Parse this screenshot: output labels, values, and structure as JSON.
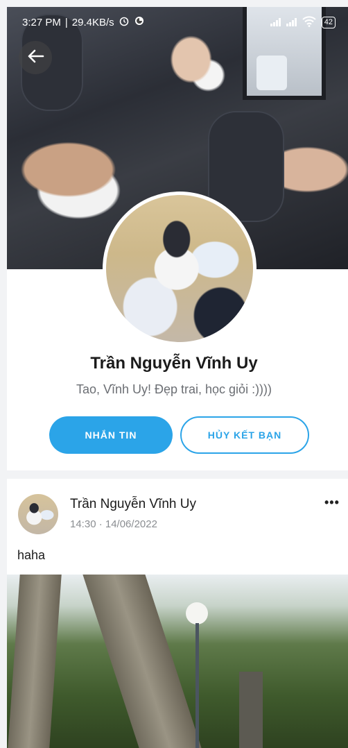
{
  "status_bar": {
    "time": "3:27 PM",
    "speed": "29.4KB/s",
    "battery": "42"
  },
  "icons": {
    "back": "arrow-left-icon",
    "alarm": "alarm-icon",
    "sync": "sync-icon",
    "signal": "signal-icon",
    "wifi": "wifi-icon",
    "battery": "battery-icon",
    "more": "more-horizontal-icon"
  },
  "profile": {
    "name": "Trần Nguyễn Vĩnh Uy",
    "bio": "Tao, Vĩnh Uy! Đẹp trai, học giỏi :))))",
    "message_button": "NHẮN TIN",
    "unfriend_button": "HỦY KẾT BẠN"
  },
  "post": {
    "author": "Trần Nguyễn Vĩnh Uy",
    "time": "14:30 · 14/06/2022",
    "more_label": "•••",
    "text": "haha"
  },
  "colors": {
    "accent": "#2ba4e8",
    "background": "#f2f3f5",
    "card": "#ffffff"
  }
}
